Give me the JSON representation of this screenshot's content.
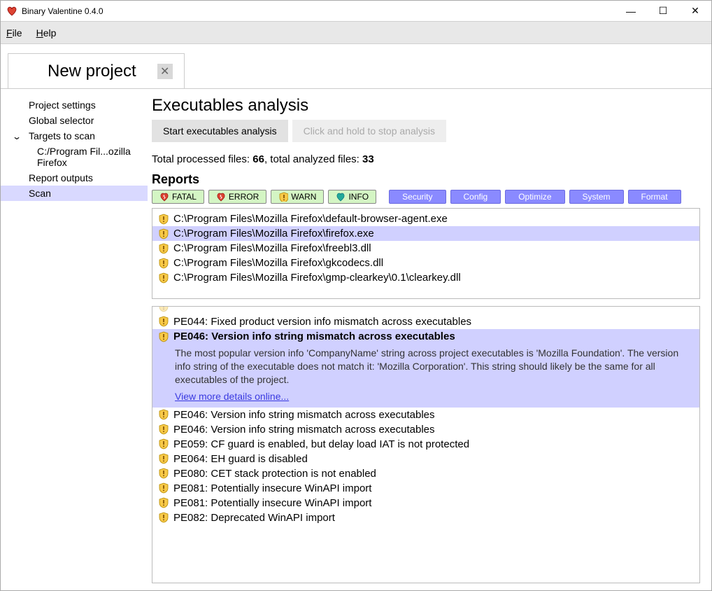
{
  "window": {
    "title": "Binary Valentine 0.4.0"
  },
  "menu": {
    "file": "File",
    "help": "Help"
  },
  "tab": {
    "label": "New project"
  },
  "sidebar": {
    "items": [
      {
        "label": "Project settings"
      },
      {
        "label": "Global selector"
      },
      {
        "label": "Targets to scan",
        "expandable": true
      },
      {
        "label": "C:/Program Fil...ozilla Firefox",
        "indent": true
      },
      {
        "label": "Report outputs"
      },
      {
        "label": "Scan",
        "selected": true
      }
    ]
  },
  "main": {
    "heading": "Executables analysis",
    "start_btn": "Start executables analysis",
    "stop_btn": "Click and hold to stop analysis",
    "stats_prefix": "Total processed files: ",
    "stats_processed": "66",
    "stats_mid": ", total analyzed files: ",
    "stats_analyzed": "33",
    "reports_header": "Reports",
    "severity": [
      "FATAL",
      "ERROR",
      "WARN",
      "INFO"
    ],
    "categories": [
      "Security",
      "Config",
      "Optimize",
      "System",
      "Format"
    ],
    "files": [
      "C:\\Program Files\\Mozilla Firefox\\default-browser-agent.exe",
      "C:\\Program Files\\Mozilla Firefox\\firefox.exe",
      "C:\\Program Files\\Mozilla Firefox\\freebl3.dll",
      "C:\\Program Files\\Mozilla Firefox\\gkcodecs.dll",
      "C:\\Program Files\\Mozilla Firefox\\gmp-clearkey\\0.1\\clearkey.dll"
    ],
    "selected_file_index": 1,
    "issues_top_cutoff": "",
    "issues": [
      {
        "title": "PE044: Fixed product version info mismatch across executables"
      },
      {
        "title": "PE046: Version info string mismatch across executables",
        "expanded": true,
        "body": "The most popular version info 'CompanyName' string across project executables is 'Mozilla Foundation'. The version info string of the executable does not match it: 'Mozilla Corporation'. This string should likely be the same for all executables of the project.",
        "link": "View more details online..."
      },
      {
        "title": "PE046: Version info string mismatch across executables"
      },
      {
        "title": "PE046: Version info string mismatch across executables"
      },
      {
        "title": "PE059: CF guard is enabled, but delay load IAT is not protected"
      },
      {
        "title": "PE064: EH guard is disabled"
      },
      {
        "title": "PE080: CET stack protection is not enabled"
      },
      {
        "title": "PE081: Potentially insecure WinAPI import"
      },
      {
        "title": "PE081: Potentially insecure WinAPI import"
      },
      {
        "title": "PE082: Deprecated WinAPI import"
      }
    ]
  }
}
